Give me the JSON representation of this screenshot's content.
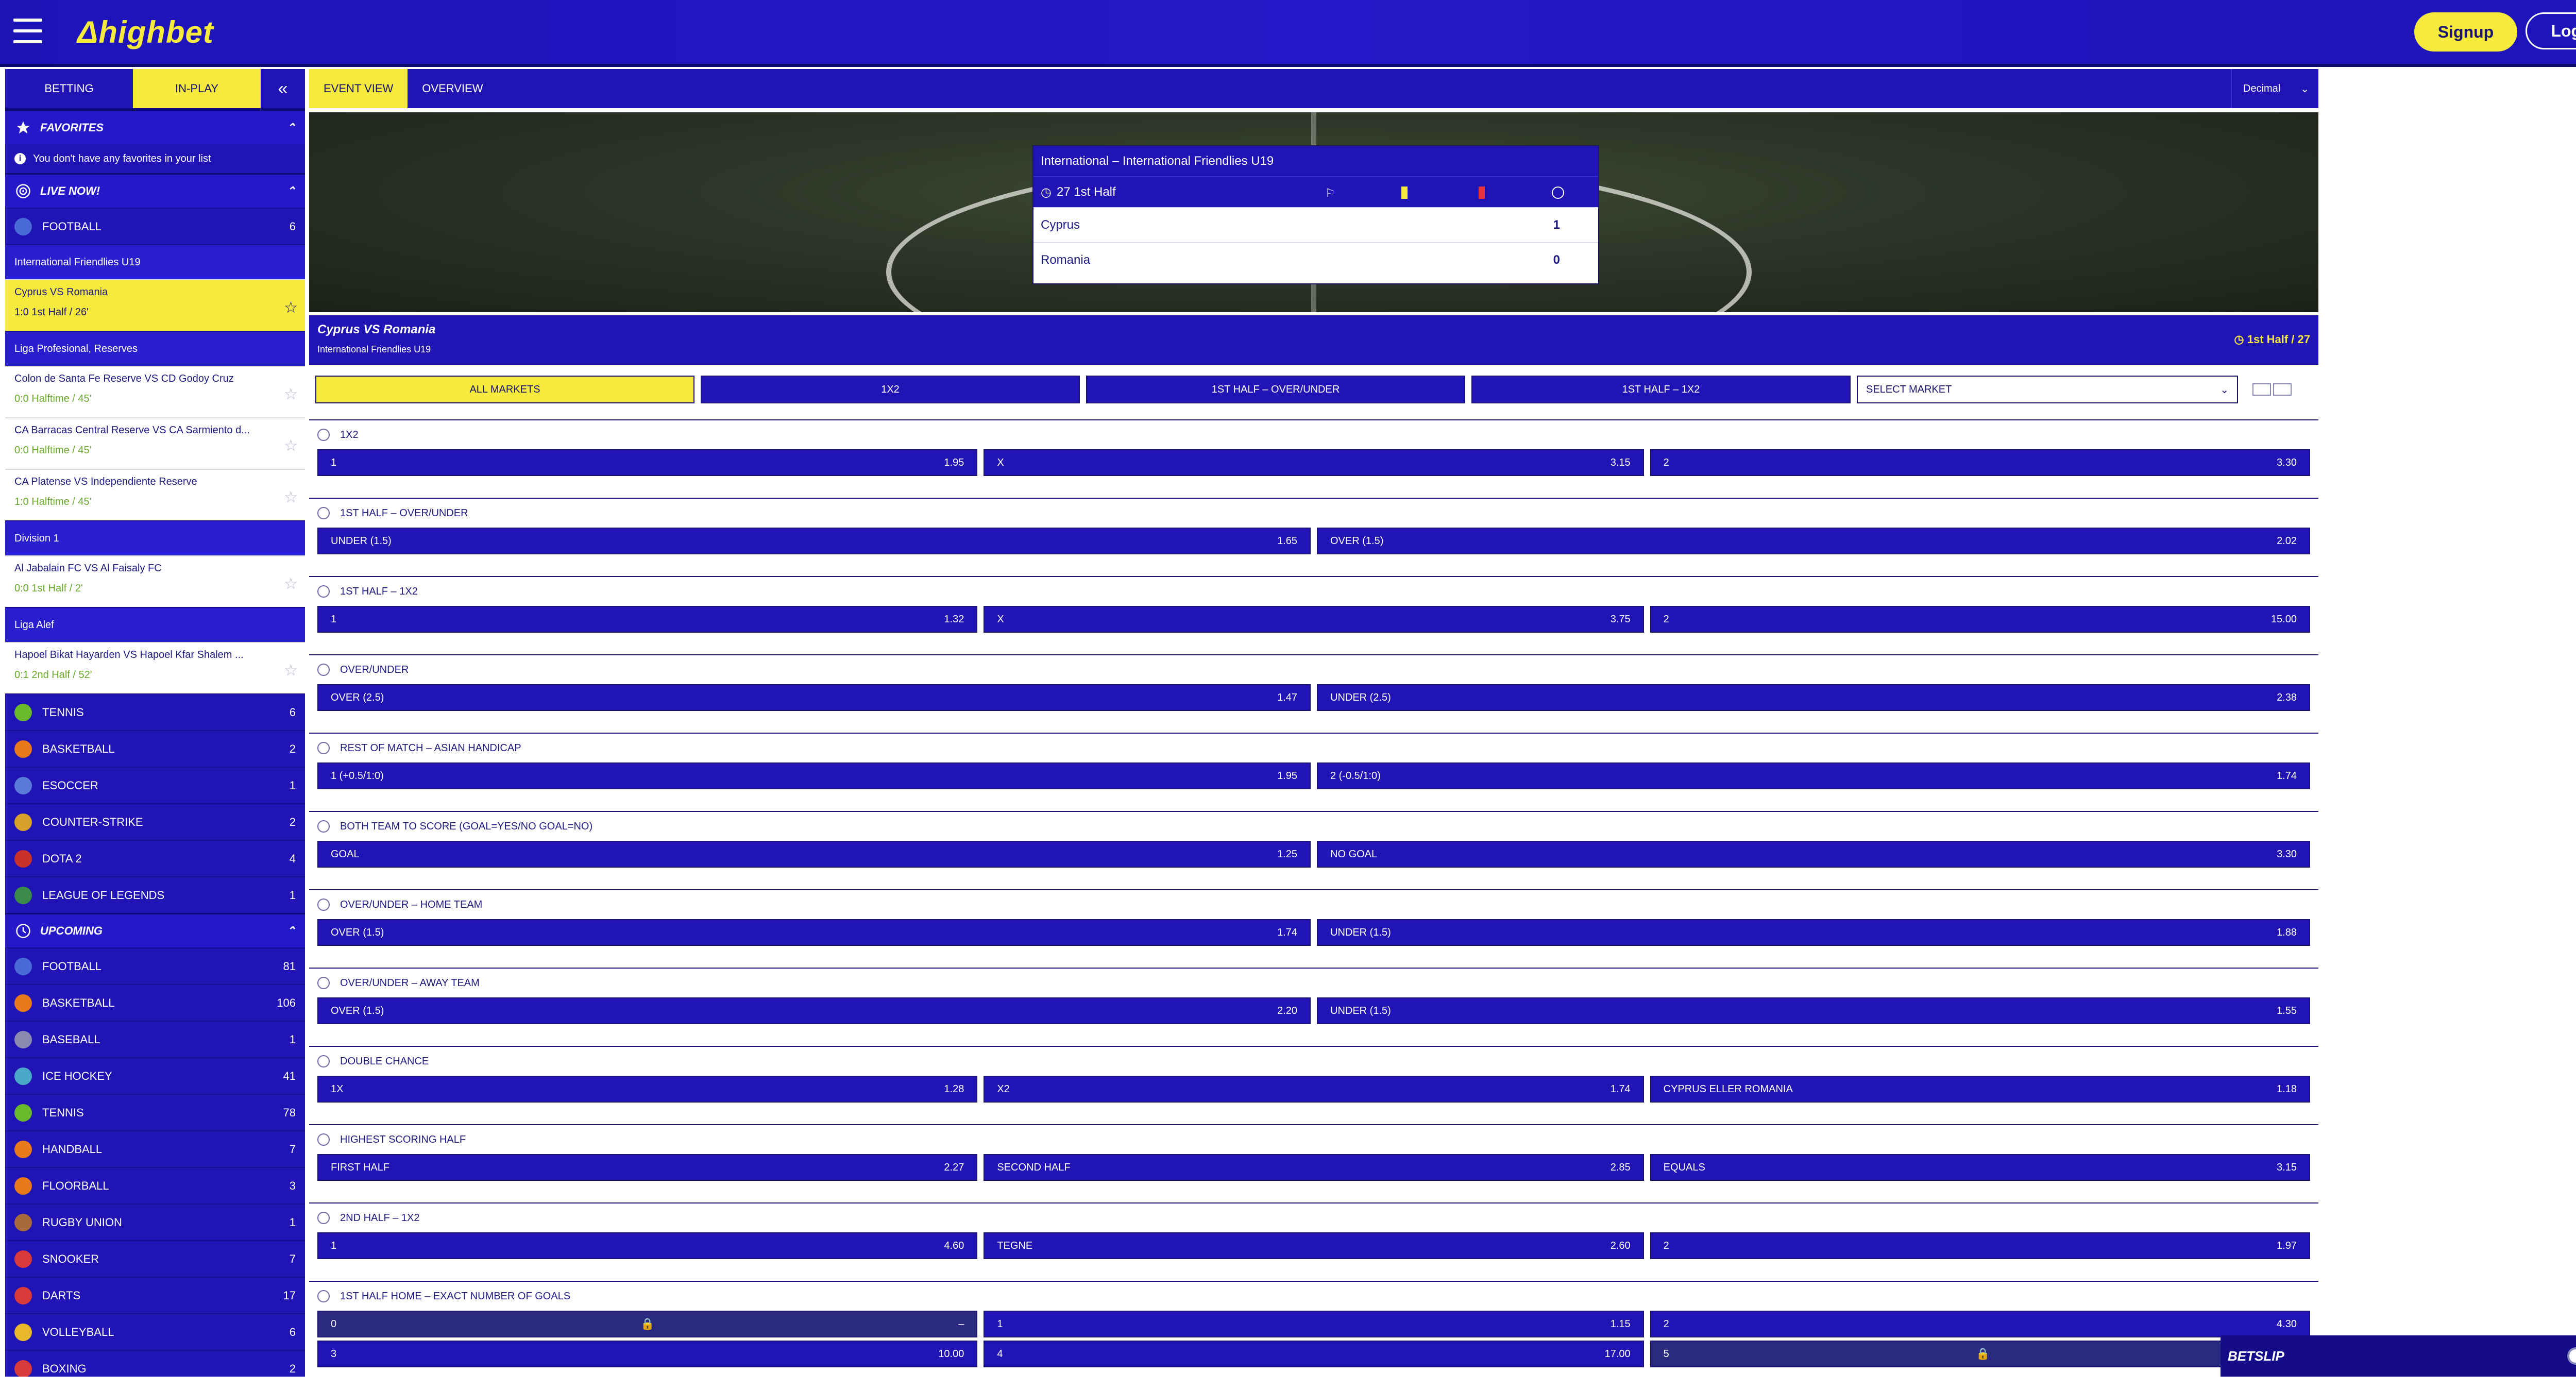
{
  "header": {
    "logo": "Δhighbet",
    "signup": "Signup",
    "login": "Login"
  },
  "sidebar": {
    "tab_betting": "BETTING",
    "tab_inplay": "IN-PLAY",
    "collapse": "«",
    "favorites": {
      "title": "FAVORITES",
      "note": "You don't have any favorites in your list"
    },
    "live": {
      "title": "LIVE NOW!",
      "football": {
        "label": "FOOTBALL",
        "count": "6"
      },
      "groups": [
        {
          "league": "International Friendlies U19",
          "matches": [
            {
              "name": "Cyprus VS Romania",
              "score": "1:0 1st Half / 26'"
            }
          ]
        },
        {
          "league": "Liga Profesional, Reserves",
          "matches": [
            {
              "name": "Colon de Santa Fe Reserve VS CD Godoy Cruz",
              "score": "0:0 Halftime / 45'"
            },
            {
              "name": "CA Barracas Central Reserve VS CA Sarmiento d...",
              "score": "0:0 Halftime / 45'"
            },
            {
              "name": "CA Platense VS Independiente Reserve",
              "score": "1:0 Halftime / 45'"
            }
          ]
        },
        {
          "league": "Division 1",
          "matches": [
            {
              "name": "Al Jabalain FC VS Al Faisaly FC",
              "score": "0:0 1st Half / 2'"
            }
          ]
        },
        {
          "league": "Liga Alef",
          "matches": [
            {
              "name": "Hapoel Bikat Hayarden VS Hapoel Kfar Shalem ...",
              "score": "0:1 2nd Half / 52'"
            }
          ]
        }
      ],
      "sports": [
        {
          "label": "TENNIS",
          "count": "6",
          "color": "#6ab82c"
        },
        {
          "label": "BASKETBALL",
          "count": "2",
          "color": "#e87a1c"
        },
        {
          "label": "ESOCCER",
          "count": "1",
          "color": "#5a7ad8"
        },
        {
          "label": "COUNTER-STRIKE",
          "count": "2",
          "color": "#d8a22a"
        },
        {
          "label": "DOTA 2",
          "count": "4",
          "color": "#c8322a"
        },
        {
          "label": "LEAGUE OF LEGENDS",
          "count": "1",
          "color": "#3a8a4a"
        }
      ]
    },
    "upcoming": {
      "title": "UPCOMING",
      "sports": [
        {
          "label": "FOOTBALL",
          "count": "81",
          "color": "#4a6ad8"
        },
        {
          "label": "BASKETBALL",
          "count": "106",
          "color": "#e87a1c"
        },
        {
          "label": "BASEBALL",
          "count": "1",
          "color": "#8a8ab0"
        },
        {
          "label": "ICE HOCKEY",
          "count": "41",
          "color": "#4aa8c8"
        },
        {
          "label": "TENNIS",
          "count": "78",
          "color": "#6ab82c"
        },
        {
          "label": "HANDBALL",
          "count": "7",
          "color": "#e87a1c"
        },
        {
          "label": "FLOORBALL",
          "count": "3",
          "color": "#e87a1c"
        },
        {
          "label": "RUGBY UNION",
          "count": "1",
          "color": "#a86a3a"
        },
        {
          "label": "SNOOKER",
          "count": "7",
          "color": "#d83a3a"
        },
        {
          "label": "DARTS",
          "count": "17",
          "color": "#d83a3a"
        },
        {
          "label": "VOLLEYBALL",
          "count": "6",
          "color": "#e8b82a"
        },
        {
          "label": "BOXING",
          "count": "2",
          "color": "#d83a3a"
        }
      ]
    }
  },
  "main": {
    "tab_event": "EVENT VIEW",
    "tab_overview": "OVERVIEW",
    "odds_format": "Decimal",
    "scoreboard": {
      "title": "International – International Friendlies U19",
      "time": "27 1st Half",
      "home": "Cyprus",
      "home_score": "1",
      "away": "Romania",
      "away_score": "0"
    },
    "event": {
      "title": "Cyprus VS Romania",
      "league": "International Friendlies U19",
      "time": "1st Half / 27"
    },
    "filters": {
      "all": "ALL MARKETS",
      "f1": "1X2",
      "f2": "1ST HALF – OVER/UNDER",
      "f3": "1ST HALF – 1X2",
      "select": "SELECT MARKET"
    },
    "markets": [
      {
        "title": "1X2",
        "rows": [
          [
            {
              "l": "1",
              "p": "1.95"
            },
            {
              "l": "X",
              "p": "3.15"
            },
            {
              "l": "2",
              "p": "3.30"
            }
          ]
        ]
      },
      {
        "title": "1ST HALF – OVER/UNDER",
        "rows": [
          [
            {
              "l": "UNDER (1.5)",
              "p": "1.65"
            },
            {
              "l": "OVER (1.5)",
              "p": "2.02"
            }
          ]
        ]
      },
      {
        "title": "1ST HALF – 1X2",
        "rows": [
          [
            {
              "l": "1",
              "p": "1.32"
            },
            {
              "l": "X",
              "p": "3.75"
            },
            {
              "l": "2",
              "p": "15.00"
            }
          ]
        ]
      },
      {
        "title": "OVER/UNDER",
        "rows": [
          [
            {
              "l": "OVER (2.5)",
              "p": "1.47"
            },
            {
              "l": "UNDER (2.5)",
              "p": "2.38"
            }
          ]
        ]
      },
      {
        "title": "REST OF MATCH – ASIAN HANDICAP",
        "rows": [
          [
            {
              "l": "1 (+0.5/1:0)",
              "p": "1.95"
            },
            {
              "l": "2 (-0.5/1:0)",
              "p": "1.74"
            }
          ]
        ]
      },
      {
        "title": "BOTH TEAM TO SCORE (GOAL=YES/NO GOAL=NO)",
        "rows": [
          [
            {
              "l": "GOAL",
              "p": "1.25"
            },
            {
              "l": "NO GOAL",
              "p": "3.30"
            }
          ]
        ]
      },
      {
        "title": "OVER/UNDER – HOME TEAM",
        "rows": [
          [
            {
              "l": "OVER (1.5)",
              "p": "1.74"
            },
            {
              "l": "UNDER (1.5)",
              "p": "1.88"
            }
          ]
        ]
      },
      {
        "title": "OVER/UNDER – AWAY TEAM",
        "rows": [
          [
            {
              "l": "OVER (1.5)",
              "p": "2.20"
            },
            {
              "l": "UNDER (1.5)",
              "p": "1.55"
            }
          ]
        ]
      },
      {
        "title": "DOUBLE CHANCE",
        "rows": [
          [
            {
              "l": "1X",
              "p": "1.28"
            },
            {
              "l": "X2",
              "p": "1.74"
            },
            {
              "l": "CYPRUS ELLER ROMANIA",
              "p": "1.18"
            }
          ]
        ]
      },
      {
        "title": "HIGHEST SCORING HALF",
        "rows": [
          [
            {
              "l": "FIRST HALF",
              "p": "2.27"
            },
            {
              "l": "SECOND HALF",
              "p": "2.85"
            },
            {
              "l": "EQUALS",
              "p": "3.15"
            }
          ]
        ]
      },
      {
        "title": "2ND HALF – 1X2",
        "rows": [
          [
            {
              "l": "1",
              "p": "4.60"
            },
            {
              "l": "TEGNE",
              "p": "2.60"
            },
            {
              "l": "2",
              "p": "1.97"
            }
          ]
        ]
      },
      {
        "title": "1ST HALF HOME – EXACT NUMBER OF GOALS",
        "rows": [
          [
            {
              "l": "0",
              "p": "–",
              "locked": true
            },
            {
              "l": "1",
              "p": "1.15"
            },
            {
              "l": "2",
              "p": "4.30"
            }
          ],
          [
            {
              "l": "3",
              "p": "10.00"
            },
            {
              "l": "4",
              "p": "17.00"
            },
            {
              "l": "5",
              "p": "",
              "locked": true
            }
          ]
        ]
      }
    ]
  },
  "betslip": {
    "title": "BETSLIP"
  }
}
